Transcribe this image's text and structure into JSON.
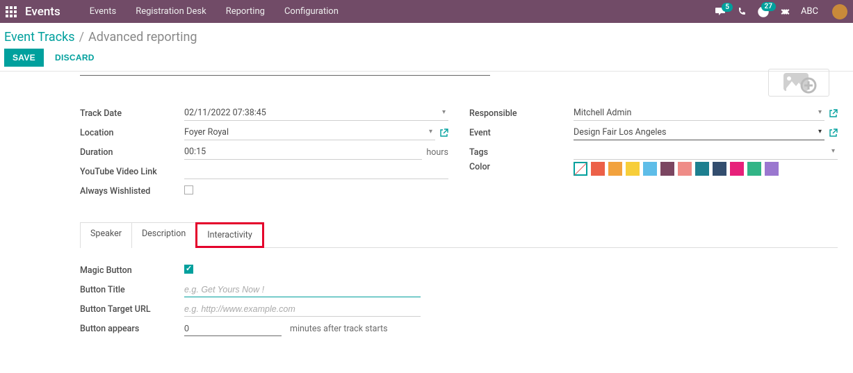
{
  "topbar": {
    "brand": "Events",
    "nav": [
      "Events",
      "Registration Desk",
      "Reporting",
      "Configuration"
    ],
    "chat_badge": "5",
    "activity_badge": "27",
    "user": "ABC"
  },
  "breadcrumb": {
    "root": "Event Tracks",
    "sep": "/",
    "current": "Advanced reporting"
  },
  "actions": {
    "save": "SAVE",
    "discard": "DISCARD"
  },
  "left": {
    "track_date_lbl": "Track Date",
    "track_date": "02/11/2022 07:38:45",
    "location_lbl": "Location",
    "location": "Foyer Royal",
    "duration_lbl": "Duration",
    "duration": "00:15",
    "duration_suffix": "hours",
    "youtube_lbl": "YouTube Video Link",
    "youtube": "",
    "always_lbl": "Always Wishlisted"
  },
  "right": {
    "responsible_lbl": "Responsible",
    "responsible": "Mitchell Admin",
    "event_lbl": "Event",
    "event": "Design Fair Los Angeles",
    "tags_lbl": "Tags",
    "tags": "",
    "color_lbl": "Color"
  },
  "colors": [
    "none",
    "#ec6048",
    "#f2a23d",
    "#f7ce3a",
    "#5ebde8",
    "#7b4661",
    "#ef8c87",
    "#1d7f8f",
    "#334d6e",
    "#e7217a",
    "#32b586",
    "#9a77cf"
  ],
  "tabs": [
    "Speaker",
    "Description",
    "Interactivity"
  ],
  "panel": {
    "magic_lbl": "Magic Button",
    "title_lbl": "Button Title",
    "title_ph": "e.g. Get Yours Now !",
    "url_lbl": "Button Target URL",
    "url_ph": "e.g. http://www.example.com",
    "appears_lbl": "Button appears",
    "appears_val": "0",
    "appears_suffix": "minutes after track starts"
  }
}
